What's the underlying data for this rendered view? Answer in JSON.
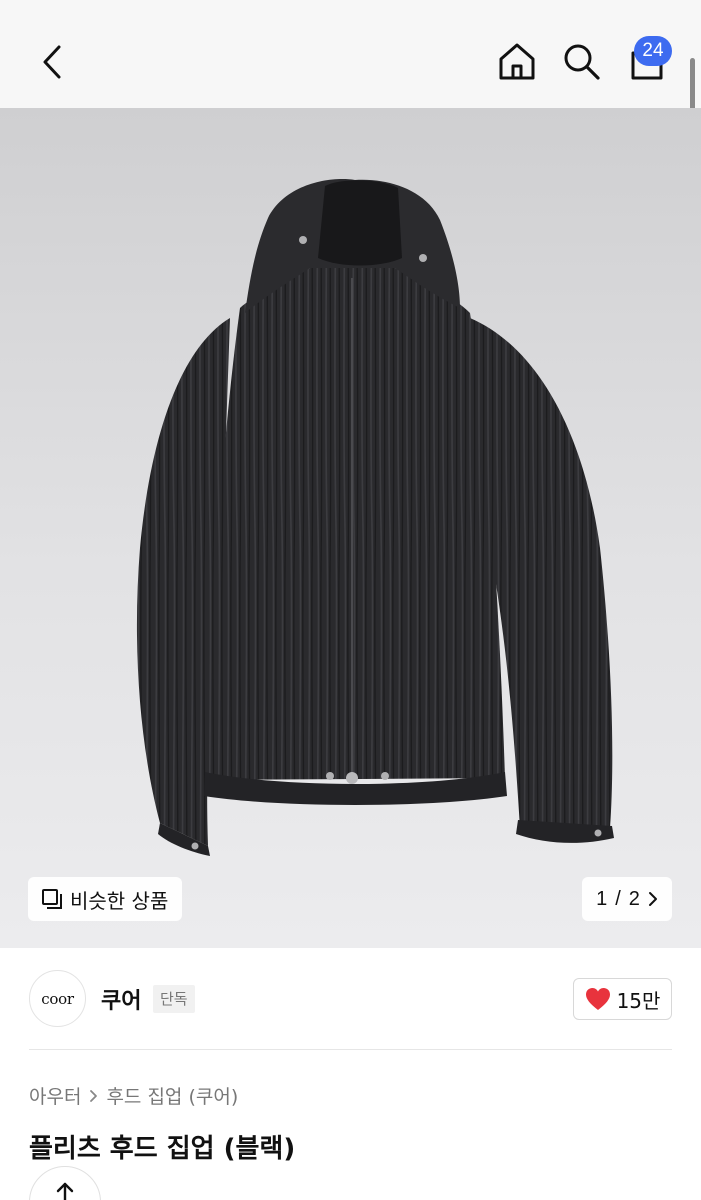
{
  "header": {
    "back_icon": "chevron-left-icon",
    "home_icon": "home-icon",
    "search_icon": "search-icon",
    "cart_icon": "shopping-bag-icon",
    "cart_badge": "24",
    "badge_color": "#3d6bf0"
  },
  "gallery": {
    "image_subject": "black pleated hooded zip-up jacket",
    "similar_label": "비슷한 상품",
    "similar_icon": "similar-items-icon",
    "pager_current": "1",
    "pager_separator": "/",
    "pager_total": "2",
    "pager_icon": "chevron-right-icon"
  },
  "brand": {
    "logo_text": "coor",
    "name": "쿠어",
    "tag": "단독",
    "like_icon": "heart-icon",
    "like_color": "#e8333d",
    "like_count": "15만"
  },
  "product": {
    "breadcrumb": [
      "아우터",
      "후드 집업 (쿠어)"
    ],
    "title": "플리츠 후드 집업 (블랙)",
    "share_icon": "share-icon"
  }
}
